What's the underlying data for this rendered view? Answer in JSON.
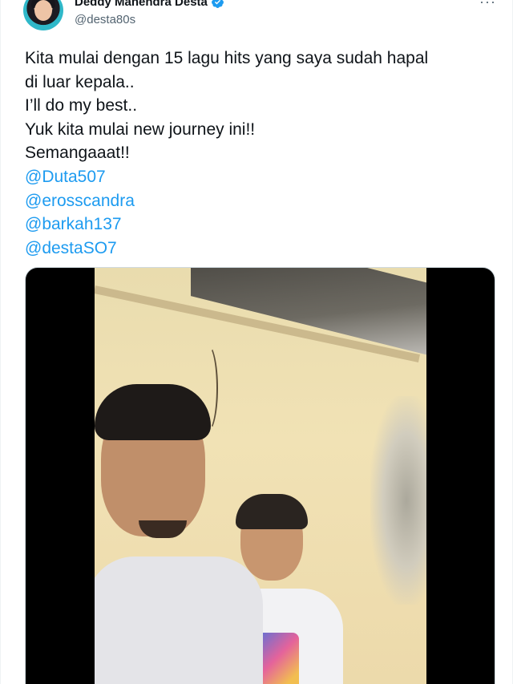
{
  "author": {
    "display_name": "Deddy Mahendra Desta",
    "handle": "@desta80s",
    "verified": true
  },
  "tweet": {
    "lines": [
      "Kita mulai dengan 15 lagu hits yang saya sudah hapal",
      "di luar kepala..",
      "I’ll do my best..",
      "Yuk kita mulai new journey ini!!",
      "Semangaaat!!"
    ],
    "mentions": [
      "@Duta507",
      "@erosscandra",
      "@barkah137",
      "@destaSO7"
    ]
  },
  "menu": {
    "more_label": "···"
  },
  "colors": {
    "link": "#1d9bf0",
    "verified": "#1d9bf0",
    "text": "#0f1419",
    "secondary": "#536471"
  },
  "icons": {
    "verified": "verified-badge-icon",
    "more": "more-dots-icon"
  }
}
